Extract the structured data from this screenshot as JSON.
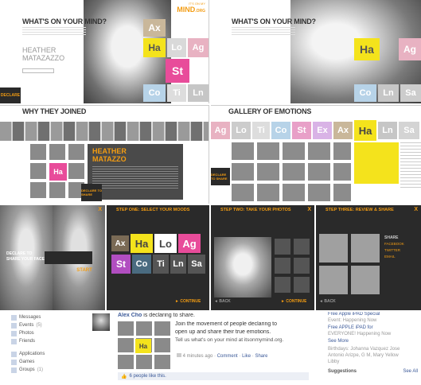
{
  "brand": {
    "logo_top": "IT'S ON MY",
    "logo_main": "MIND",
    "logo_suffix": ".ORG"
  },
  "panel1": {
    "title": "WHAT'S ON YOUR MIND?",
    "name_first": "HEATHER",
    "name_last": "MATAZAZZO",
    "cta": "DECLARE",
    "tiles": [
      "Ax",
      "Ha",
      "Lo",
      "Ag",
      "St",
      "Co",
      "Ti",
      "Ln",
      "Sa"
    ]
  },
  "panel2": {
    "title": "WHAT'S ON YOUR MIND?",
    "tiles": [
      "Ha",
      "Ag",
      "Co",
      "Ln",
      "Sa"
    ]
  },
  "panel3": {
    "title": "WHY THEY JOINED",
    "name_first": "HEATHER",
    "name_last": "MATAZZO",
    "cta": "DECLARE TO SHARE"
  },
  "panel4": {
    "title": "GALLERY OF EMOTIONS",
    "tiles": [
      "Ag",
      "Lo",
      "Ti",
      "Co",
      "St",
      "Ex",
      "Ax",
      "Ha",
      "Ln",
      "Sa"
    ],
    "cta": "DECLARE TO SHARE"
  },
  "panel5": {
    "declare": "DECLARE TO SHARE YOUR FACE",
    "start": "START",
    "corner": "X"
  },
  "panel6": {
    "step": "STEP ONE:",
    "step_title": "SELECT YOUR MOODS",
    "tiles": [
      "Ax",
      "Ha",
      "Lo",
      "Ag",
      "St",
      "Co",
      "Ti",
      "Ln",
      "Sa"
    ],
    "continue": "CONTINUE"
  },
  "panel7": {
    "step": "STEP TWO:",
    "step_title": "TAKE YOUR PHOTOS",
    "back": "BACK",
    "continue": "CONTINUE",
    "corner": "X"
  },
  "panel8": {
    "step": "STEP THREE:",
    "step_title": "REVIEW & SHARE",
    "share": "SHARE",
    "back": "BACK",
    "corner": "X",
    "options": [
      "FACEBOOK",
      "TWITTER",
      "EMAIL"
    ]
  },
  "facebook": {
    "sidebar": [
      {
        "label": "Messages"
      },
      {
        "label": "Events",
        "count": "(5)"
      },
      {
        "label": "Photos"
      },
      {
        "label": "Friends"
      },
      {
        "label": "Applications"
      },
      {
        "label": "Games"
      },
      {
        "label": "Groups",
        "count": "(1)"
      }
    ],
    "post_author": "Alex Cho",
    "post_action": "is declaring to share.",
    "post_line1": "Join the movement of people declaring to",
    "post_line2": "open up and share their true emotions.",
    "post_line3": "Tell us what's on your mind at itsonmymind.org.",
    "post_time": "4 minutes ago",
    "post_comment": "Comment",
    "post_like": "Like",
    "post_share": "Share",
    "likes": "6 people like this.",
    "right_ad1": "Free Apple iPAD Special",
    "right_ad2": "Event: Happening Now",
    "right_ad3": "Free APPLE iPAD for",
    "right_ad4": "EVERYONE! Happening Now",
    "see_more": "See More",
    "birthday1": "Birthdays: Johanna Vazquez Jose",
    "birthday2": "Antonio Arizpe, G M, Mary Yellow",
    "birthday3": "Libby",
    "suggestions": "Suggestions",
    "see_all": "See All"
  },
  "colors": {
    "orange": "#f39c12",
    "yellow": "#f4e31c",
    "pink": "#e84c9a",
    "purple": "#8a59a8",
    "dark": "#2a2a2a",
    "fb_blue": "#3b5998"
  }
}
